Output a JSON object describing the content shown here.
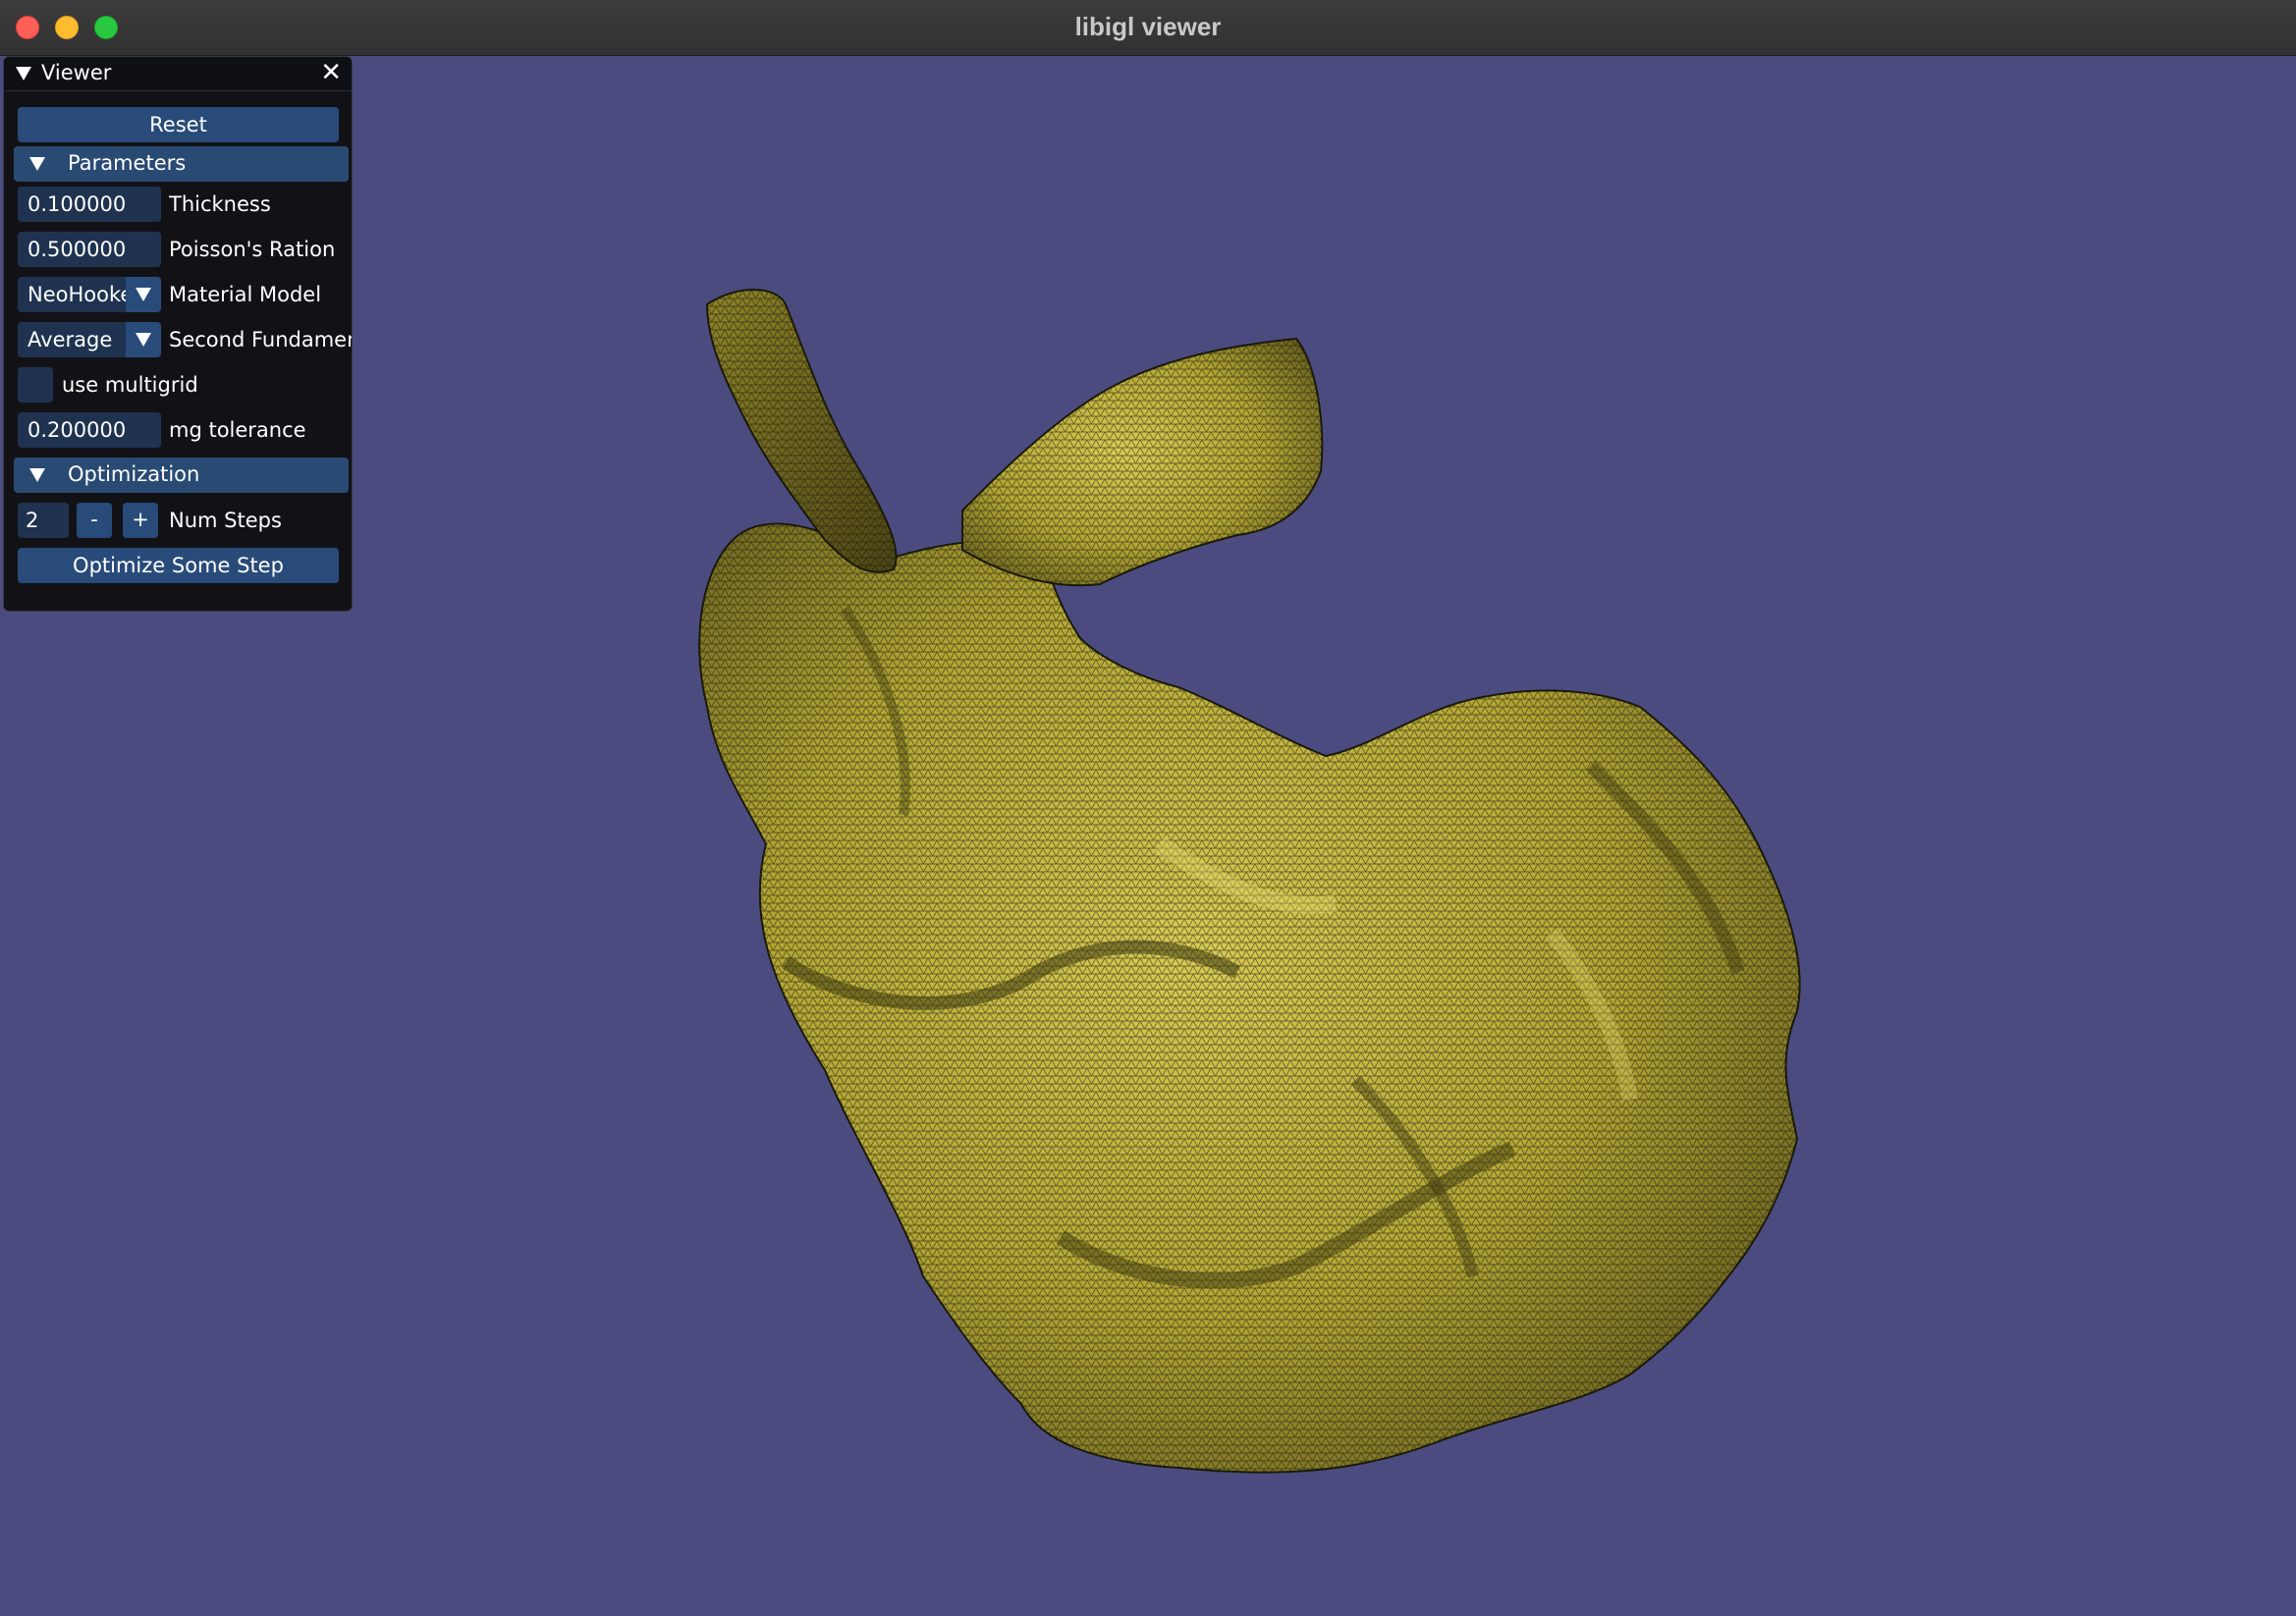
{
  "window": {
    "title": "libigl viewer"
  },
  "panel": {
    "title": "Viewer",
    "reset_label": "Reset",
    "parameters": {
      "header": "Parameters",
      "thickness_value": "0.100000",
      "thickness_label": "Thickness",
      "poisson_value": "0.500000",
      "poisson_label": "Poisson's Ration",
      "material_value": "NeoHooke",
      "material_label": "Material Model",
      "second_fund_value": "Average",
      "second_fund_label": "Second Fundamen",
      "multigrid_label": "use multigrid",
      "multigrid_checked": false,
      "mg_tol_value": "0.200000",
      "mg_tol_label": "mg tolerance"
    },
    "optimization": {
      "header": "Optimization",
      "num_steps_value": "2",
      "minus_label": "-",
      "plus_label": "+",
      "num_steps_label": "Num Steps",
      "optimize_label": "Optimize Some Step"
    }
  },
  "colors": {
    "background": "#4c4b80",
    "mesh_fill": "#b3a634",
    "mesh_wire": "#1a1a0a",
    "button": "#284b7a",
    "frame": "#1f3350"
  },
  "icons": {
    "close": "close-icon",
    "collapse": "triangle-down-icon",
    "combo_arrow": "chevron-down-icon"
  }
}
